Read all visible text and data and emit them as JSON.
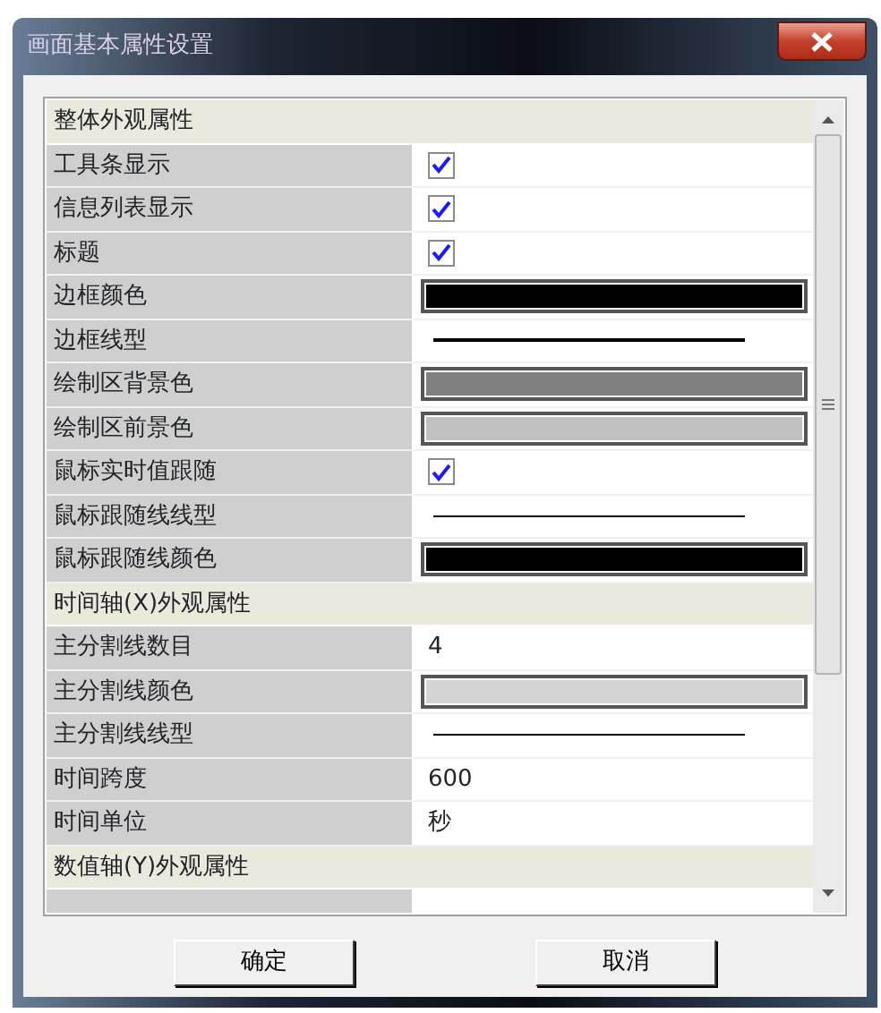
{
  "window": {
    "title": "画面基本属性设置"
  },
  "groups": [
    {
      "title": "整体外观属性",
      "items": [
        {
          "kind": "check",
          "label": "工具条显示",
          "checked": true
        },
        {
          "kind": "check",
          "label": "信息列表显示",
          "checked": true
        },
        {
          "kind": "check",
          "label": "标题",
          "checked": true
        },
        {
          "kind": "color",
          "label": "边框颜色",
          "color": "#000000"
        },
        {
          "kind": "line",
          "label": "边框线型",
          "bold": true
        },
        {
          "kind": "color",
          "label": "绘制区背景色",
          "color": "#808080"
        },
        {
          "kind": "color",
          "label": "绘制区前景色",
          "color": "#c0c0c0"
        },
        {
          "kind": "check",
          "label": "鼠标实时值跟随",
          "checked": true
        },
        {
          "kind": "line",
          "label": "鼠标跟随线线型",
          "bold": false
        },
        {
          "kind": "color",
          "label": "鼠标跟随线颜色",
          "color": "#000000"
        }
      ]
    },
    {
      "title": "时间轴(X)外观属性",
      "items": [
        {
          "kind": "text",
          "label": "主分割线数目",
          "value": "4"
        },
        {
          "kind": "color",
          "label": "主分割线颜色",
          "color": "#d4d4d4"
        },
        {
          "kind": "line",
          "label": "主分割线线型",
          "bold": false
        },
        {
          "kind": "text",
          "label": "时间跨度",
          "value": "600"
        },
        {
          "kind": "text",
          "label": "时间单位",
          "value": "秒"
        }
      ]
    },
    {
      "title": "数值轴(Y)外观属性"
    }
  ],
  "buttons": [
    "确定",
    "取消"
  ]
}
